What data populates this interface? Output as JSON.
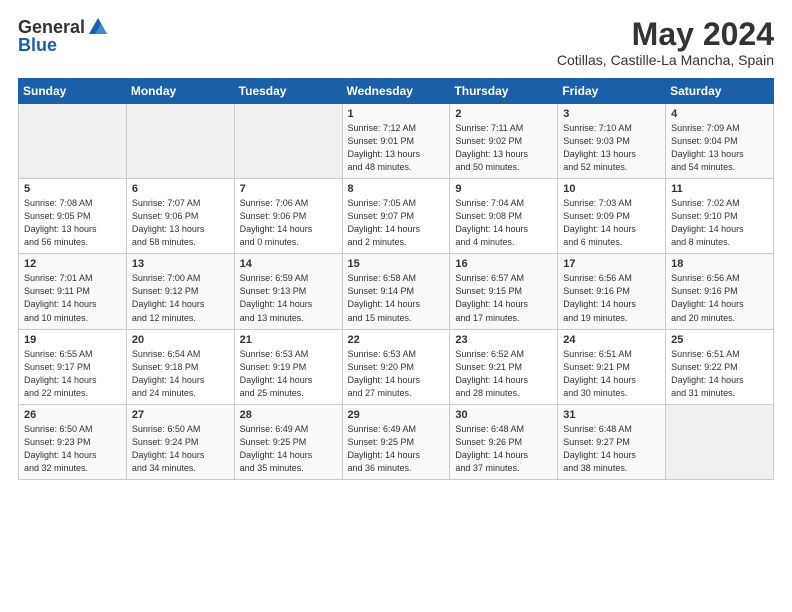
{
  "header": {
    "logo_general": "General",
    "logo_blue": "Blue",
    "month_year": "May 2024",
    "location": "Cotillas, Castille-La Mancha, Spain"
  },
  "days_of_week": [
    "Sunday",
    "Monday",
    "Tuesday",
    "Wednesday",
    "Thursday",
    "Friday",
    "Saturday"
  ],
  "weeks": [
    [
      {
        "day": "",
        "info": ""
      },
      {
        "day": "",
        "info": ""
      },
      {
        "day": "",
        "info": ""
      },
      {
        "day": "1",
        "info": "Sunrise: 7:12 AM\nSunset: 9:01 PM\nDaylight: 13 hours\nand 48 minutes."
      },
      {
        "day": "2",
        "info": "Sunrise: 7:11 AM\nSunset: 9:02 PM\nDaylight: 13 hours\nand 50 minutes."
      },
      {
        "day": "3",
        "info": "Sunrise: 7:10 AM\nSunset: 9:03 PM\nDaylight: 13 hours\nand 52 minutes."
      },
      {
        "day": "4",
        "info": "Sunrise: 7:09 AM\nSunset: 9:04 PM\nDaylight: 13 hours\nand 54 minutes."
      }
    ],
    [
      {
        "day": "5",
        "info": "Sunrise: 7:08 AM\nSunset: 9:05 PM\nDaylight: 13 hours\nand 56 minutes."
      },
      {
        "day": "6",
        "info": "Sunrise: 7:07 AM\nSunset: 9:06 PM\nDaylight: 13 hours\nand 58 minutes."
      },
      {
        "day": "7",
        "info": "Sunrise: 7:06 AM\nSunset: 9:06 PM\nDaylight: 14 hours\nand 0 minutes."
      },
      {
        "day": "8",
        "info": "Sunrise: 7:05 AM\nSunset: 9:07 PM\nDaylight: 14 hours\nand 2 minutes."
      },
      {
        "day": "9",
        "info": "Sunrise: 7:04 AM\nSunset: 9:08 PM\nDaylight: 14 hours\nand 4 minutes."
      },
      {
        "day": "10",
        "info": "Sunrise: 7:03 AM\nSunset: 9:09 PM\nDaylight: 14 hours\nand 6 minutes."
      },
      {
        "day": "11",
        "info": "Sunrise: 7:02 AM\nSunset: 9:10 PM\nDaylight: 14 hours\nand 8 minutes."
      }
    ],
    [
      {
        "day": "12",
        "info": "Sunrise: 7:01 AM\nSunset: 9:11 PM\nDaylight: 14 hours\nand 10 minutes."
      },
      {
        "day": "13",
        "info": "Sunrise: 7:00 AM\nSunset: 9:12 PM\nDaylight: 14 hours\nand 12 minutes."
      },
      {
        "day": "14",
        "info": "Sunrise: 6:59 AM\nSunset: 9:13 PM\nDaylight: 14 hours\nand 13 minutes."
      },
      {
        "day": "15",
        "info": "Sunrise: 6:58 AM\nSunset: 9:14 PM\nDaylight: 14 hours\nand 15 minutes."
      },
      {
        "day": "16",
        "info": "Sunrise: 6:57 AM\nSunset: 9:15 PM\nDaylight: 14 hours\nand 17 minutes."
      },
      {
        "day": "17",
        "info": "Sunrise: 6:56 AM\nSunset: 9:16 PM\nDaylight: 14 hours\nand 19 minutes."
      },
      {
        "day": "18",
        "info": "Sunrise: 6:56 AM\nSunset: 9:16 PM\nDaylight: 14 hours\nand 20 minutes."
      }
    ],
    [
      {
        "day": "19",
        "info": "Sunrise: 6:55 AM\nSunset: 9:17 PM\nDaylight: 14 hours\nand 22 minutes."
      },
      {
        "day": "20",
        "info": "Sunrise: 6:54 AM\nSunset: 9:18 PM\nDaylight: 14 hours\nand 24 minutes."
      },
      {
        "day": "21",
        "info": "Sunrise: 6:53 AM\nSunset: 9:19 PM\nDaylight: 14 hours\nand 25 minutes."
      },
      {
        "day": "22",
        "info": "Sunrise: 6:53 AM\nSunset: 9:20 PM\nDaylight: 14 hours\nand 27 minutes."
      },
      {
        "day": "23",
        "info": "Sunrise: 6:52 AM\nSunset: 9:21 PM\nDaylight: 14 hours\nand 28 minutes."
      },
      {
        "day": "24",
        "info": "Sunrise: 6:51 AM\nSunset: 9:21 PM\nDaylight: 14 hours\nand 30 minutes."
      },
      {
        "day": "25",
        "info": "Sunrise: 6:51 AM\nSunset: 9:22 PM\nDaylight: 14 hours\nand 31 minutes."
      }
    ],
    [
      {
        "day": "26",
        "info": "Sunrise: 6:50 AM\nSunset: 9:23 PM\nDaylight: 14 hours\nand 32 minutes."
      },
      {
        "day": "27",
        "info": "Sunrise: 6:50 AM\nSunset: 9:24 PM\nDaylight: 14 hours\nand 34 minutes."
      },
      {
        "day": "28",
        "info": "Sunrise: 6:49 AM\nSunset: 9:25 PM\nDaylight: 14 hours\nand 35 minutes."
      },
      {
        "day": "29",
        "info": "Sunrise: 6:49 AM\nSunset: 9:25 PM\nDaylight: 14 hours\nand 36 minutes."
      },
      {
        "day": "30",
        "info": "Sunrise: 6:48 AM\nSunset: 9:26 PM\nDaylight: 14 hours\nand 37 minutes."
      },
      {
        "day": "31",
        "info": "Sunrise: 6:48 AM\nSunset: 9:27 PM\nDaylight: 14 hours\nand 38 minutes."
      },
      {
        "day": "",
        "info": ""
      }
    ]
  ]
}
